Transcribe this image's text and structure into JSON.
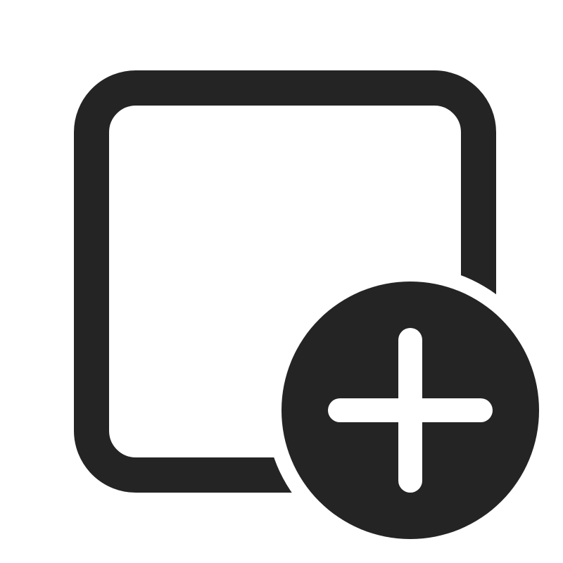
{
  "icon": {
    "name": "square-add-icon",
    "parts": [
      "rounded-square-outline",
      "plus-circle-badge",
      "plus-sign"
    ]
  },
  "colors": {
    "background": "#ffffff",
    "foreground": "#242424",
    "plus": "#ffffff"
  }
}
